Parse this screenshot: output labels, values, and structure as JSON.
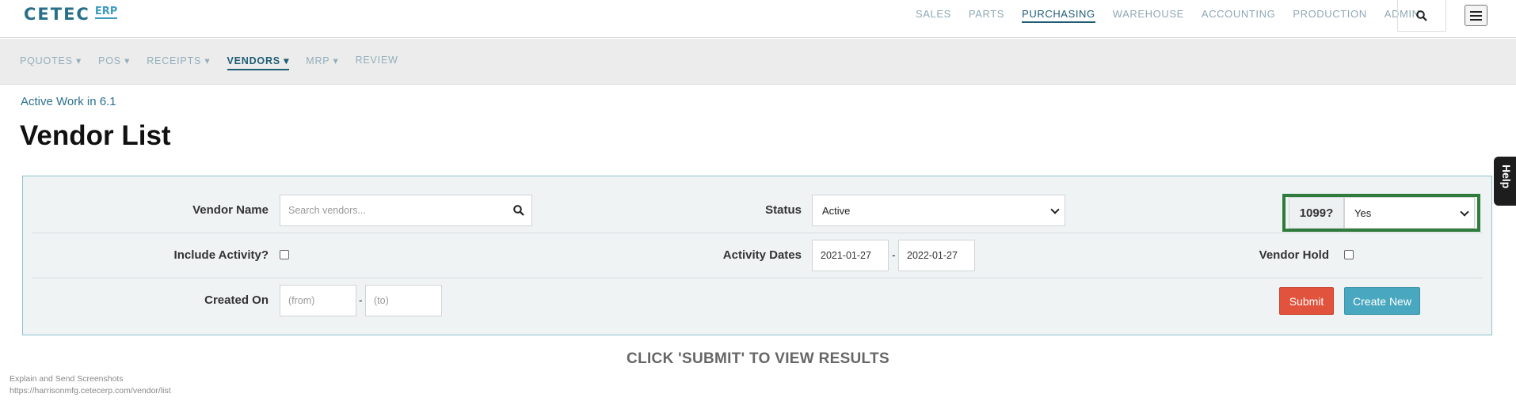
{
  "logo": {
    "main": "CETEC",
    "sub": "ERP"
  },
  "main_nav": [
    {
      "label": "SALES",
      "active": false
    },
    {
      "label": "PARTS",
      "active": false
    },
    {
      "label": "PURCHASING",
      "active": true
    },
    {
      "label": "WAREHOUSE",
      "active": false
    },
    {
      "label": "ACCOUNTING",
      "active": false
    },
    {
      "label": "PRODUCTION",
      "active": false
    },
    {
      "label": "ADMIN",
      "active": false
    }
  ],
  "sub_nav": [
    {
      "label": "PQUOTES ▾",
      "active": false
    },
    {
      "label": "POS ▾",
      "active": false
    },
    {
      "label": "RECEIPTS ▾",
      "active": false
    },
    {
      "label": "VENDORS ▾",
      "active": true
    },
    {
      "label": "MRP ▾",
      "active": false
    },
    {
      "label": "REVIEW",
      "active": false
    }
  ],
  "breadcrumb": "Active Work in 6.1",
  "page_title": "Vendor List",
  "filters": {
    "vendor_name_label": "Vendor Name",
    "vendor_name_placeholder": "Search vendors...",
    "status_label": "Status",
    "status_value": "Active",
    "form_1099_label": "1099?",
    "form_1099_value": "Yes",
    "include_activity_label": "Include Activity?",
    "activity_dates_label": "Activity Dates",
    "activity_from": "2021-01-27",
    "activity_to": "2022-01-27",
    "vendor_hold_label": "Vendor Hold",
    "created_on_label": "Created On",
    "created_from_placeholder": "(from)",
    "created_to_placeholder": "(to)",
    "range_separator": "-"
  },
  "buttons": {
    "submit": "Submit",
    "create_new": "Create New"
  },
  "help_tab": "Help",
  "results_message": "CLICK 'SUBMIT' TO VIEW RESULTS",
  "footer": {
    "line1": "Explain and Send Screenshots",
    "line2": "https://harrisonmfg.cetecerp.com/vendor/list"
  }
}
